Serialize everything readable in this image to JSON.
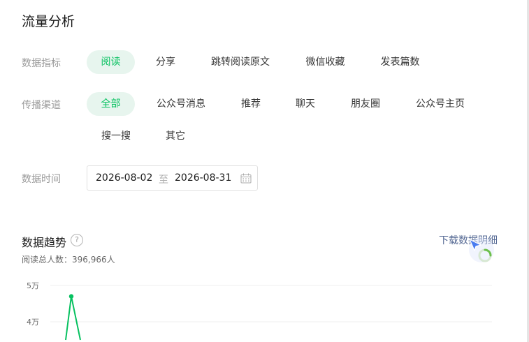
{
  "page": {
    "title": "流量分析"
  },
  "metric": {
    "label": "数据指标",
    "options": [
      "阅读",
      "分享",
      "跳转阅读原文",
      "微信收藏",
      "发表篇数"
    ],
    "selected": "阅读"
  },
  "channel": {
    "label": "传播渠道",
    "options": [
      "全部",
      "公众号消息",
      "推荐",
      "聊天",
      "朋友圈",
      "公众号主页",
      "搜一搜",
      "其它"
    ],
    "selected": "全部"
  },
  "time": {
    "label": "数据时间",
    "start": "2026-08-02",
    "separator": "至",
    "end": "2026-08-31"
  },
  "trend": {
    "title": "数据趋势",
    "help": "?",
    "download": "下载数据明细",
    "summary": "阅读总人数：396,966人"
  },
  "colors": {
    "accent": "#07c160",
    "accent_bg": "#e7f5ee",
    "link": "#576b95"
  },
  "chart_data": {
    "type": "line",
    "yticks": [
      "5万",
      "4万"
    ],
    "ylim": [
      40000,
      50000
    ],
    "series": [
      {
        "color": "#07c160",
        "points": [
          [
            0,
            35000
          ],
          [
            1,
            47000
          ],
          [
            2,
            35000
          ]
        ]
      }
    ],
    "xlim": [
      0,
      29
    ],
    "grid": true
  }
}
